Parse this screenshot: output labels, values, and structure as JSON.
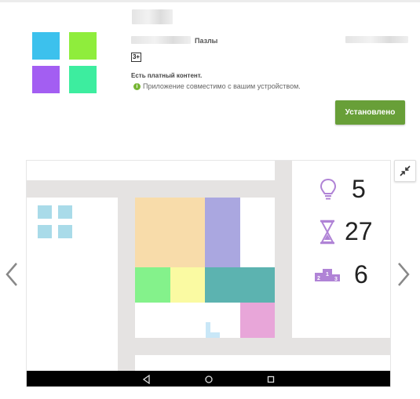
{
  "app": {
    "category": "Пазлы",
    "age_rating": "3+",
    "paid_content": "Есть платный контент.",
    "compatibility": "Приложение совместимо с вашим устройством.",
    "install_button": "Установлено"
  },
  "icons": {
    "compat": "info-icon",
    "prev": "chevron-left-icon",
    "next": "chevron-right-icon",
    "fullscreen": "collapse-icon",
    "hint": "lightbulb-icon",
    "moves": "hourglass-icon",
    "level": "podium-icon",
    "nav_back": "back-triangle-icon",
    "nav_home": "home-circle-icon",
    "nav_recent": "recent-square-icon"
  },
  "colors": {
    "install_button": "#689f38",
    "icon_tiles": [
      "#3cc1ed",
      "#8fed3c",
      "#a35ef2",
      "#3ded9f"
    ],
    "stat_icons": "#b083d6"
  },
  "screenshot": {
    "stats": [
      {
        "icon": "lightbulb-icon",
        "value": "5"
      },
      {
        "icon": "hourglass-icon",
        "value": "27"
      },
      {
        "icon": "podium-icon",
        "value": "6"
      }
    ]
  }
}
